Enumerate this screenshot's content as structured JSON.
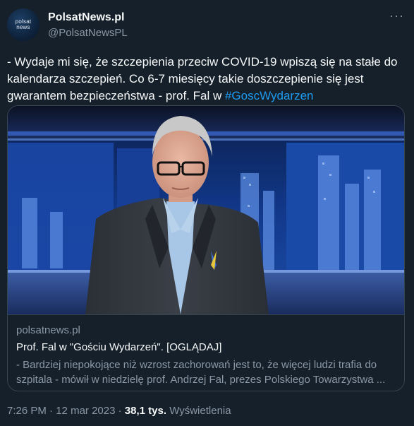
{
  "author": {
    "name": "PolsatNews.pl",
    "handle": "@PolsatNewsPL",
    "avatar_line1": "polsat",
    "avatar_line2": "news"
  },
  "tweet": {
    "text": "- Wydaje mi się, że szczepienia przeciw COVID-19  wpiszą się na stałe do kalendarza szczepień. Co 6-7 miesięcy takie doszczepienie się jest gwarantem bezpieczeństwa - prof. Fal w ",
    "hashtag": "#GoscWydarzen"
  },
  "card": {
    "domain": "polsatnews.pl",
    "title": "Prof. Fal w \"Gościu Wydarzeń\". [OGLĄDAJ]",
    "description": "- Bardziej niepokojące niż wzrost zachorowań jest to, że więcej ludzi trafia do szpitala - mówił w niedzielę prof. Andrzej Fal, prezes Polskiego Towarzystwa ..."
  },
  "footer": {
    "time": "7:26 PM",
    "separator": " · ",
    "date": "12 mar 2023",
    "views_count": "38,1 tys.",
    "views_label": "Wyświetlenia"
  },
  "more_menu": "···",
  "colors": {
    "background": "#15202b",
    "accent": "#1d9bf0",
    "secondary_text": "#8b98a5",
    "border": "#38444d"
  }
}
